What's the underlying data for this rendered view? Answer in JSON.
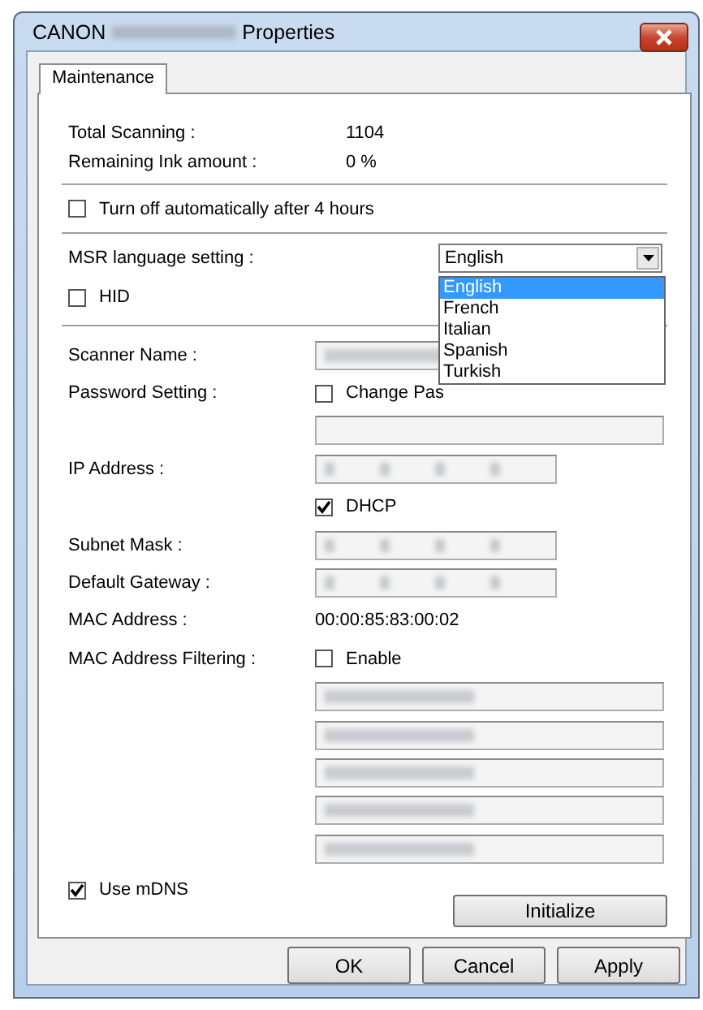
{
  "window": {
    "title_start": "CANON",
    "title_end": "Properties",
    "title_blurred": true
  },
  "tabs": [
    {
      "label": "Maintenance",
      "selected": true
    }
  ],
  "info": [
    {
      "label": "Total Scanning :",
      "value": "1104"
    },
    {
      "label": "Remaining Ink amount :",
      "value": "0 %"
    }
  ],
  "auto_off": {
    "label": "Turn off automatically after 4 hours",
    "checked": false
  },
  "msr": {
    "label": "MSR language setting :",
    "value": "English",
    "expanded": true,
    "options": [
      {
        "label": "English",
        "selected": true
      },
      {
        "label": "French",
        "selected": false
      },
      {
        "label": "Italian",
        "selected": false
      },
      {
        "label": "Spanish",
        "selected": false
      },
      {
        "label": "Turkish",
        "selected": false
      }
    ]
  },
  "hid": {
    "label": "HID",
    "checked": false
  },
  "rows": [
    {
      "kind": "field",
      "label": "Scanner Name :",
      "field": {
        "kind": "text",
        "blurred": true
      }
    },
    {
      "kind": "check",
      "label": "Password Setting :",
      "check": {
        "label": "Change Pas",
        "checked": false
      }
    },
    {
      "kind": "field",
      "field": {
        "kind": "text",
        "blurred": false
      }
    },
    {
      "kind": "field",
      "label": "IP Address :",
      "field": {
        "kind": "address",
        "blurred": true
      }
    },
    {
      "kind": "check",
      "check": {
        "label": "DHCP",
        "checked": true
      }
    },
    {
      "kind": "field",
      "label": "Subnet Mask :",
      "field": {
        "kind": "address",
        "blurred": true
      }
    },
    {
      "kind": "field",
      "label": "Default Gateway :",
      "field": {
        "kind": "address",
        "blurred": true
      }
    },
    {
      "kind": "value",
      "label": "MAC Address :",
      "value": "00:00:85:83:00:02"
    },
    {
      "kind": "check",
      "label": "MAC Address Filtering :",
      "check": {
        "label": "Enable",
        "checked": false
      }
    },
    {
      "kind": "field",
      "field": {
        "kind": "text",
        "blurred": true
      }
    },
    {
      "kind": "field",
      "field": {
        "kind": "text",
        "blurred": true
      }
    },
    {
      "kind": "field",
      "field": {
        "kind": "text",
        "blurred": true
      }
    },
    {
      "kind": "field",
      "field": {
        "kind": "text",
        "blurred": true
      }
    },
    {
      "kind": "field",
      "field": {
        "kind": "text",
        "blurred": true
      }
    }
  ],
  "mdns": {
    "label": "Use mDNS",
    "checked": true
  },
  "initialize_button": "Initialize",
  "buttons": [
    "OK",
    "Cancel",
    "Apply"
  ]
}
